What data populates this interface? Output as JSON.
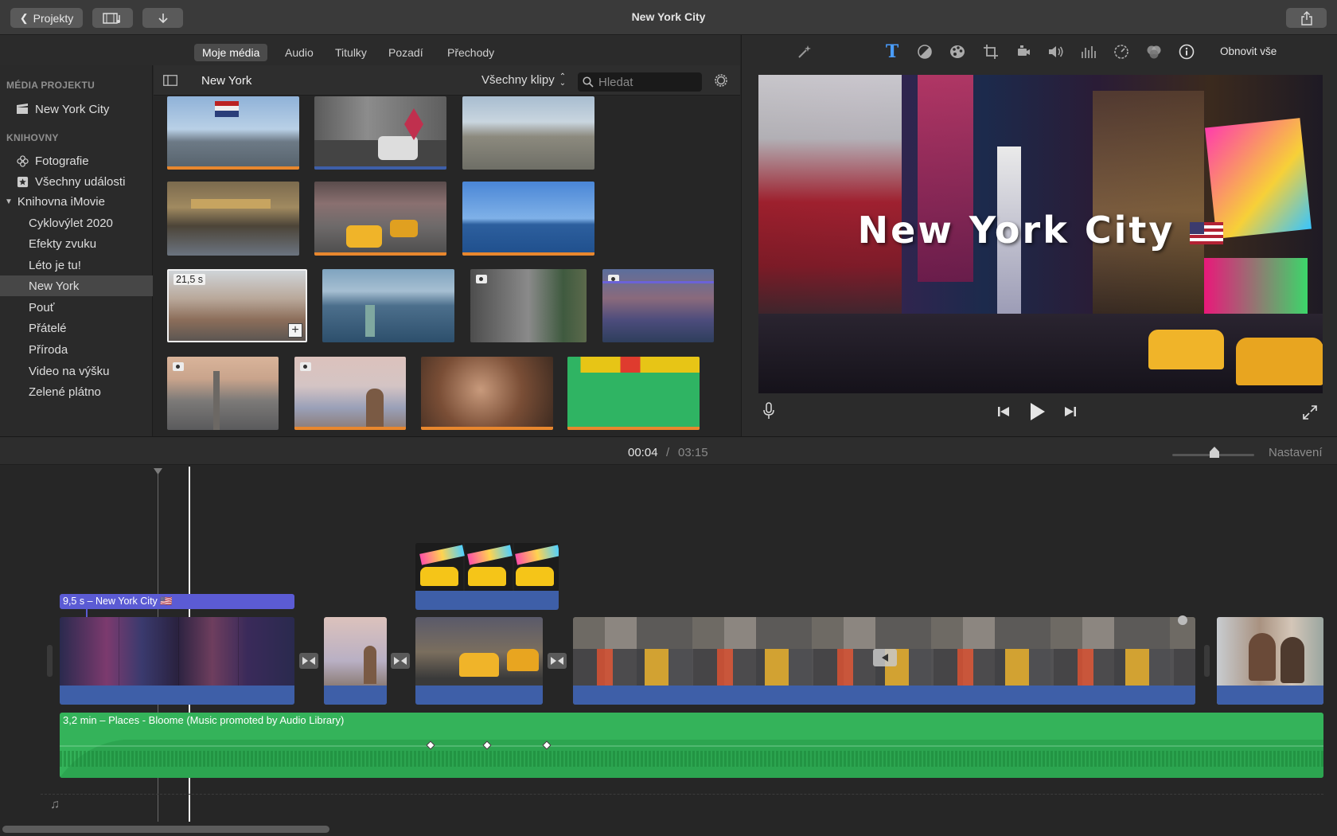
{
  "window": {
    "title": "New York City",
    "back_label": "Projekty"
  },
  "browser_tabs": [
    "Moje média",
    "Audio",
    "Titulky",
    "Pozadí",
    "Přechody"
  ],
  "sidebar": {
    "project_media_heading": "MÉDIA PROJEKTU",
    "project_item": "New York City",
    "libraries_heading": "KNIHOVNY",
    "library_items": [
      "Fotografie",
      "Všechny události"
    ],
    "imovie_library": "Knihovna iMovie",
    "events": [
      "Cyklovýlet 2020",
      "Efekty zvuku",
      "Léto je tu!",
      "New York",
      "Pouť",
      "Přátelé",
      "Příroda",
      "Video na výšku",
      "Zelené plátno"
    ],
    "selected_event": "New York"
  },
  "browser": {
    "event_title": "New York",
    "filter_label": "Všechny klipy",
    "search_placeholder": "Hledat",
    "selected_clip_duration": "21,5 s"
  },
  "viewer": {
    "reset_all_label": "Obnovit vše",
    "title_text": "New York City",
    "tools": [
      "magic-wand-icon",
      "title-text-icon",
      "color-balance-icon",
      "color-correction-icon",
      "crop-icon",
      "stabilization-icon",
      "volume-icon",
      "equalizer-icon",
      "speed-icon",
      "filter-icon",
      "info-icon"
    ]
  },
  "timeline_header": {
    "current_time": "00:04",
    "separator": "/",
    "total_time": "03:15",
    "settings_label": "Nastavení"
  },
  "timeline": {
    "title_clip_label": "9,5 s – New York City 🇺🇸",
    "music_label": "3,2 min – Places - Bloome (Music promoted by Audio Library)"
  },
  "colors": {
    "accent_orange": "#e8872e",
    "title_clip": "#5b5bd4",
    "audio_blue": "#3e5fa8",
    "music_green": "#34b35a"
  }
}
